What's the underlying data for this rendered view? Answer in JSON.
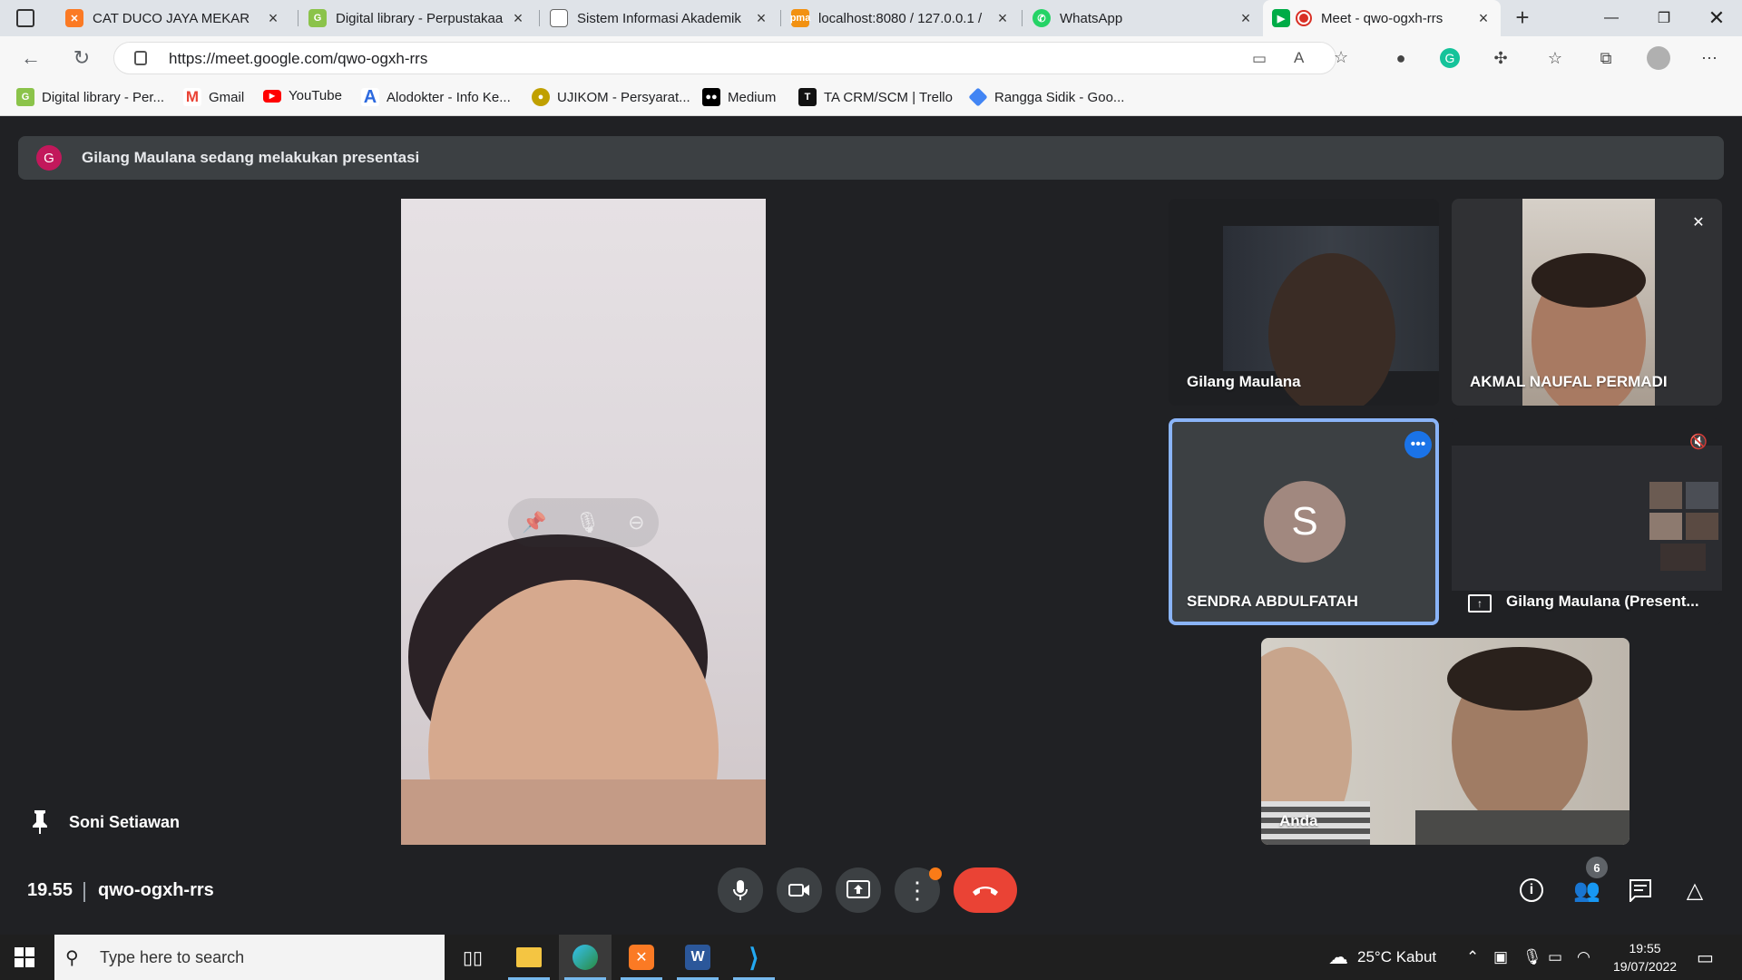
{
  "browser": {
    "tabs": [
      {
        "title": "CAT DUCO JAYA MEKAR",
        "icon": "xampp-icon",
        "color": "#fb7a24"
      },
      {
        "title": "Digital library - Perpustakaa",
        "icon": "gdl-icon",
        "color": "#8bc34a"
      },
      {
        "title": "Sistem Informasi Akademik",
        "icon": "document-icon",
        "color": "#9aa0a6"
      },
      {
        "title": "localhost:8080 / 127.0.0.1 /",
        "icon": "phpmyadmin-icon",
        "color": "#f29111"
      },
      {
        "title": "WhatsApp",
        "icon": "whatsapp-icon",
        "color": "#25d366"
      },
      {
        "title": "Meet - qwo-ogxh-rrs",
        "icon": "meet-icon",
        "color": "#00ac47"
      }
    ],
    "url": "https://meet.google.com/qwo-ogxh-rrs",
    "bookmarks": [
      {
        "label": "Digital library - Per...",
        "icon": "gdl-icon",
        "color": "#8bc34a"
      },
      {
        "label": "Gmail",
        "icon": "gmail-icon",
        "color": "#ea4335"
      },
      {
        "label": "YouTube",
        "icon": "youtube-icon",
        "color": "#ff0000"
      },
      {
        "label": "Alodokter - Info Ke...",
        "icon": "alodokter-icon",
        "color": "#2d6adf"
      },
      {
        "label": "UJIKOM - Persyarat...",
        "icon": "ujikom-icon",
        "color": "#c0a000"
      },
      {
        "label": "Medium",
        "icon": "medium-icon",
        "color": "#000000"
      },
      {
        "label": "TA CRM/SCM | Trello",
        "icon": "trello-icon",
        "color": "#111111"
      },
      {
        "label": "Rangga Sidik - Goo...",
        "icon": "drive-icon",
        "color": "#4285f4"
      }
    ]
  },
  "meet": {
    "banner_avatar": "G",
    "banner_text": "Gilang Maulana sedang melakukan presentasi",
    "pinned_name": "Soni Setiawan",
    "tiles": [
      {
        "name": "Gilang Maulana"
      },
      {
        "name": "AKMAL NAUFAL PERMADI"
      },
      {
        "name": "SENDRA ABDULFATAH",
        "avatar": "S"
      },
      {
        "name": "Gilang Maulana (Present..."
      },
      {
        "name": "Anda"
      }
    ],
    "time": "19.55",
    "meeting_code": "qwo-ogxh-rrs",
    "participant_count": "6",
    "colors": {
      "end_call": "#ea4335",
      "active_speaker": "#8ab4f8",
      "avatar_s": "#a1887f"
    }
  },
  "taskbar": {
    "search_placeholder": "Type here to search",
    "weather": "25°C  Kabut",
    "clock_time": "19:55",
    "clock_date": "19/07/2022"
  }
}
